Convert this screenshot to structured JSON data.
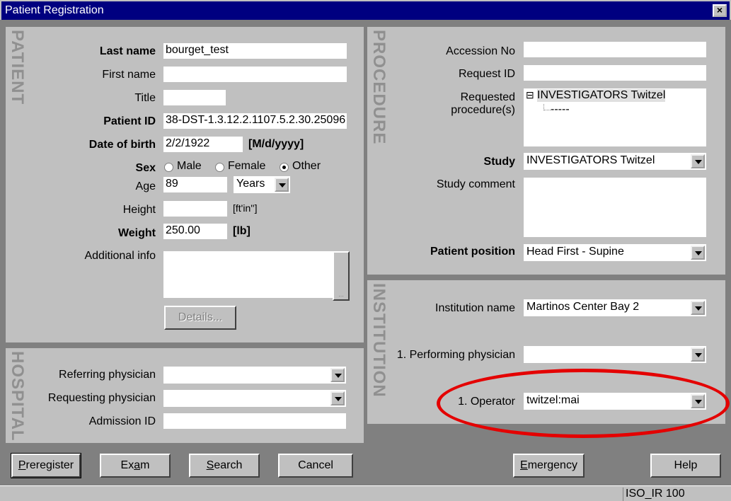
{
  "window": {
    "title": "Patient Registration"
  },
  "patient": {
    "section_label": "PATIENT",
    "last_name_label": "Last name",
    "last_name_value": "bourget_test",
    "first_name_label": "First name",
    "first_name_value": "",
    "title_label": "Title",
    "title_value": "",
    "patient_id_label": "Patient ID",
    "patient_id_value": "38-DST-1.3.12.2.1107.5.2.30.25096",
    "dob_label": "Date of birth",
    "dob_value": "2/2/1922",
    "dob_format": "[M/d/yyyy]",
    "sex_label": "Sex",
    "sex_options": [
      "Male",
      "Female",
      "Other"
    ],
    "sex_selected": "Other",
    "age_label": "Age",
    "age_value": "89",
    "age_unit": "Years",
    "height_label": "Height",
    "height_value": "",
    "height_unit": "[ft'in'']",
    "weight_label": "Weight",
    "weight_value": "250.00",
    "weight_unit": "[lb]",
    "additional_info_label": "Additional info",
    "additional_info_value": "",
    "ellipsis_label": "...",
    "details_button": "Details..."
  },
  "hospital": {
    "section_label": "HOSPITAL",
    "referring_label": "Referring physician",
    "referring_value": "",
    "requesting_label": "Requesting physician",
    "requesting_value": "",
    "admission_label": "Admission ID",
    "admission_value": ""
  },
  "procedure": {
    "section_label": "PROCEDURE",
    "accession_label": "Accession No",
    "accession_value": "",
    "request_id_label": "Request ID",
    "request_id_value": "",
    "requested_label_1": "Requested",
    "requested_label_2": "procedure(s)",
    "tree_root": "INVESTIGATORS Twitzel",
    "tree_expander": "⊟",
    "tree_child": "-----",
    "study_label": "Study",
    "study_value": "INVESTIGATORS Twitzel",
    "study_comment_label": "Study comment",
    "study_comment_value": "",
    "position_label": "Patient position",
    "position_value": "Head First - Supine"
  },
  "institution": {
    "section_label": "INSTITUTION",
    "name_label": "Institution name",
    "name_value": "Martinos Center Bay 2",
    "performing_label": "1. Performing physician",
    "performing_value": "",
    "operator_label": "1. Operator",
    "operator_value": "twitzel:mai"
  },
  "buttons": {
    "preregister_u": "P",
    "preregister_rest": "reregister",
    "exam_pre": "Ex",
    "exam_u": "a",
    "exam_post": "m",
    "search_u": "S",
    "search_rest": "earch",
    "cancel": "Cancel",
    "emergency_u": "E",
    "emergency_rest": "mergency",
    "help": "Help"
  },
  "status": {
    "encoding": "ISO_IR 100"
  },
  "colors": {
    "title_bar": "#000080",
    "panel": "#c0c0c0",
    "annotation_circle": "#e40000"
  }
}
